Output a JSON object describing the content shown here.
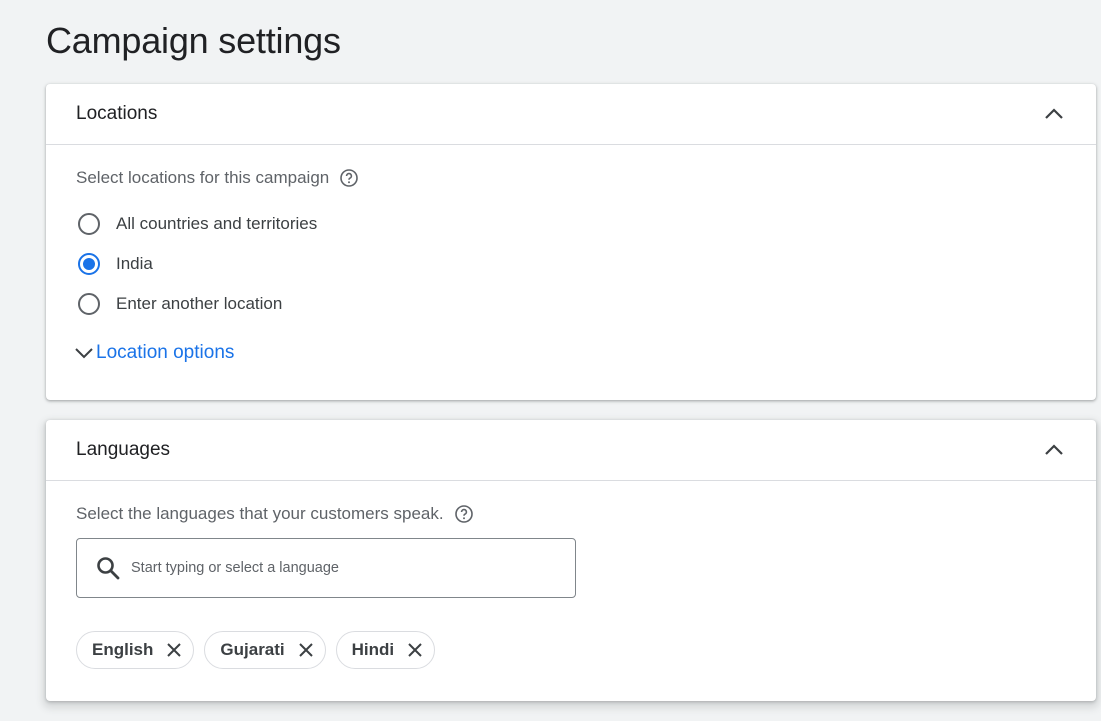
{
  "page": {
    "title": "Campaign settings"
  },
  "locations": {
    "title": "Locations",
    "description": "Select locations for this campaign",
    "options": [
      {
        "label": "All countries and territories",
        "checked": false
      },
      {
        "label": "India",
        "checked": true
      },
      {
        "label": "Enter another location",
        "checked": false
      }
    ],
    "location_options_link": "Location options"
  },
  "languages": {
    "title": "Languages",
    "description": "Select the languages that your customers speak.",
    "search": {
      "placeholder": "Start typing or select a language",
      "value": ""
    },
    "chips": [
      {
        "label": "English"
      },
      {
        "label": "Gujarati"
      },
      {
        "label": "Hindi"
      }
    ]
  },
  "colors": {
    "accent": "#1a73e8",
    "background": "#f1f3f4",
    "text_primary": "#202124",
    "text_secondary": "#5f6368"
  },
  "icons": [
    "chevron-up-icon",
    "help-icon",
    "chevron-down-icon",
    "search-icon",
    "close-icon"
  ]
}
